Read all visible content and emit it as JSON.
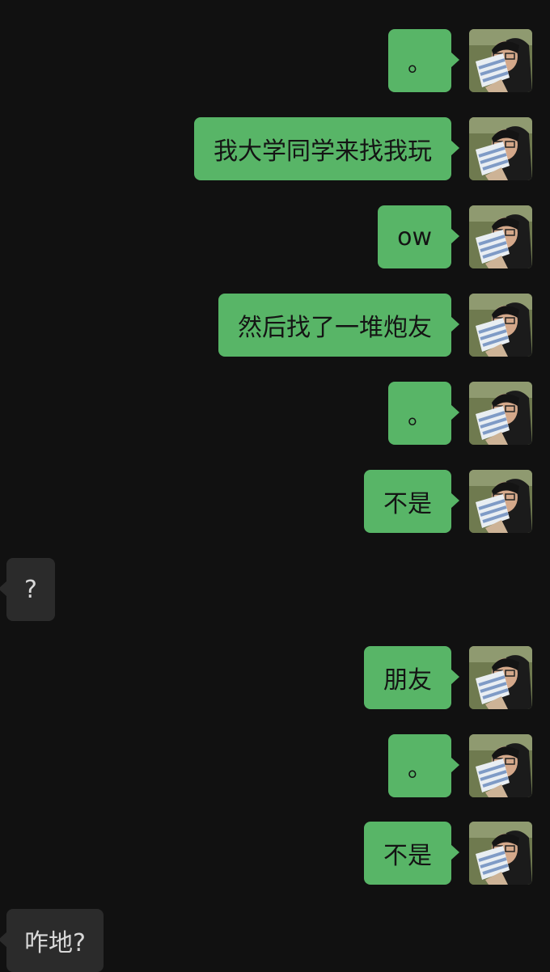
{
  "messages": [
    {
      "side": "out",
      "text": "。"
    },
    {
      "side": "out",
      "text": "我大学同学来找我玩"
    },
    {
      "side": "out",
      "text": "ow"
    },
    {
      "side": "out",
      "text": "然后找了一堆炮友"
    },
    {
      "side": "out",
      "text": "。"
    },
    {
      "side": "out",
      "text": "不是"
    },
    {
      "side": "in",
      "text": "?"
    },
    {
      "side": "out",
      "text": "朋友"
    },
    {
      "side": "out",
      "text": "。"
    },
    {
      "side": "out",
      "text": "不是"
    },
    {
      "side": "in",
      "text": "咋地?"
    }
  ],
  "colors": {
    "background": "#111111",
    "outgoing_bubble": "#58b567",
    "incoming_bubble": "#2b2b2b"
  },
  "icons": {
    "avatar": "user-avatar-photo"
  }
}
